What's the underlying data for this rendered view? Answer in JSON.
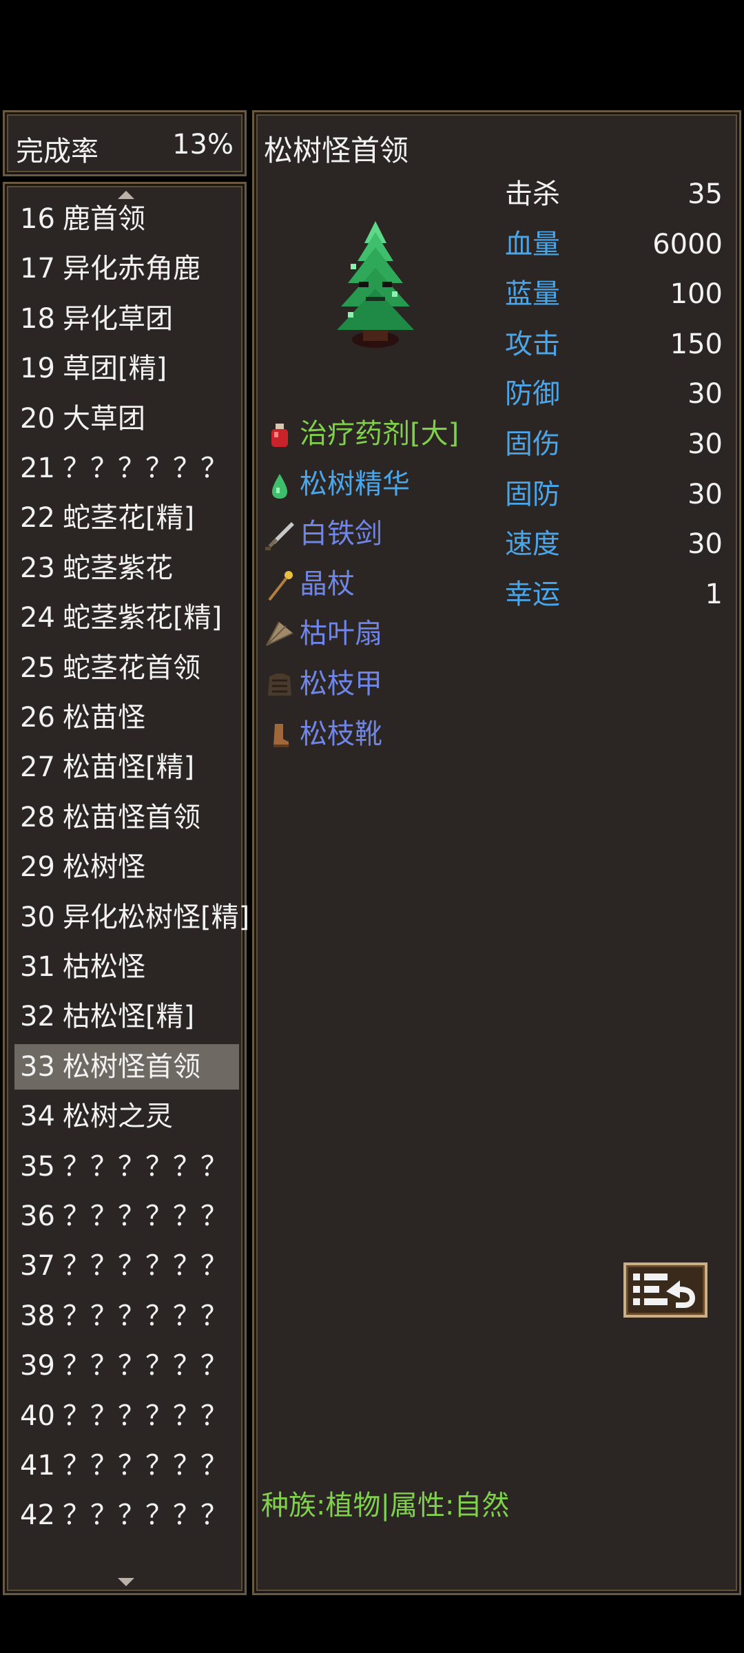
{
  "completion": {
    "label": "完成率",
    "value": "13%"
  },
  "list": [
    {
      "num": "16",
      "name": "鹿首领",
      "selected": false
    },
    {
      "num": "17",
      "name": "异化赤角鹿",
      "selected": false
    },
    {
      "num": "18",
      "name": "异化草团",
      "selected": false
    },
    {
      "num": "19",
      "name": "草团[精]",
      "selected": false
    },
    {
      "num": "20",
      "name": "大草团",
      "selected": false
    },
    {
      "num": "21",
      "name": "？？？？？？",
      "selected": false
    },
    {
      "num": "22",
      "name": "蛇茎花[精]",
      "selected": false
    },
    {
      "num": "23",
      "name": "蛇茎紫花",
      "selected": false
    },
    {
      "num": "24",
      "name": "蛇茎紫花[精]",
      "selected": false
    },
    {
      "num": "25",
      "name": "蛇茎花首领",
      "selected": false
    },
    {
      "num": "26",
      "name": "松苗怪",
      "selected": false
    },
    {
      "num": "27",
      "name": "松苗怪[精]",
      "selected": false
    },
    {
      "num": "28",
      "name": "松苗怪首领",
      "selected": false
    },
    {
      "num": "29",
      "name": "松树怪",
      "selected": false
    },
    {
      "num": "30",
      "name": "异化松树怪[精]",
      "selected": false
    },
    {
      "num": "31",
      "name": "枯松怪",
      "selected": false
    },
    {
      "num": "32",
      "name": "枯松怪[精]",
      "selected": false
    },
    {
      "num": "33",
      "name": "松树怪首领",
      "selected": true
    },
    {
      "num": "34",
      "name": "松树之灵",
      "selected": false
    },
    {
      "num": "35",
      "name": "？？？？？？",
      "selected": false
    },
    {
      "num": "36",
      "name": "？？？？？？",
      "selected": false
    },
    {
      "num": "37",
      "name": "？？？？？？",
      "selected": false
    },
    {
      "num": "38",
      "name": "？？？？？？",
      "selected": false
    },
    {
      "num": "39",
      "name": "？？？？？？",
      "selected": false
    },
    {
      "num": "40",
      "name": "？？？？？？",
      "selected": false
    },
    {
      "num": "41",
      "name": "？？？？？？",
      "selected": false
    },
    {
      "num": "42",
      "name": "？？？？？？",
      "selected": false
    }
  ],
  "detail": {
    "title": "松树怪首领",
    "sprite_icon": "pine-tree-monster-icon",
    "stats": [
      {
        "label": "击杀",
        "value": "35",
        "label_color": "#f2f2f2"
      },
      {
        "label": "血量",
        "value": "6000",
        "label_color": "#4aa6e8"
      },
      {
        "label": "蓝量",
        "value": "100",
        "label_color": "#4aa6e8"
      },
      {
        "label": "攻击",
        "value": "150",
        "label_color": "#4aa6e8"
      },
      {
        "label": "防御",
        "value": "30",
        "label_color": "#4aa6e8"
      },
      {
        "label": "固伤",
        "value": "30",
        "label_color": "#4aa6e8"
      },
      {
        "label": "固防",
        "value": "30",
        "label_color": "#4aa6e8"
      },
      {
        "label": "速度",
        "value": "30",
        "label_color": "#4aa6e8"
      },
      {
        "label": "幸运",
        "value": "1",
        "label_color": "#4aa6e8"
      }
    ],
    "drops": [
      {
        "name": "治疗药剂[大]",
        "color": "#7fd04b",
        "icon": "red-potion-icon"
      },
      {
        "name": "松树精华",
        "color": "#4aa6e8",
        "icon": "green-essence-icon"
      },
      {
        "name": "白铁剑",
        "color": "#6f86e8",
        "icon": "sword-icon"
      },
      {
        "name": "晶杖",
        "color": "#6f86e8",
        "icon": "staff-icon"
      },
      {
        "name": "枯叶扇",
        "color": "#6f86e8",
        "icon": "leaf-fan-icon"
      },
      {
        "name": "松枝甲",
        "color": "#6f86e8",
        "icon": "armor-icon"
      },
      {
        "name": "松枝靴",
        "color": "#6f86e8",
        "icon": "boot-icon"
      }
    ],
    "species_line": "种族:植物|属性:自然"
  },
  "exit_button_icon": "exit-icon"
}
